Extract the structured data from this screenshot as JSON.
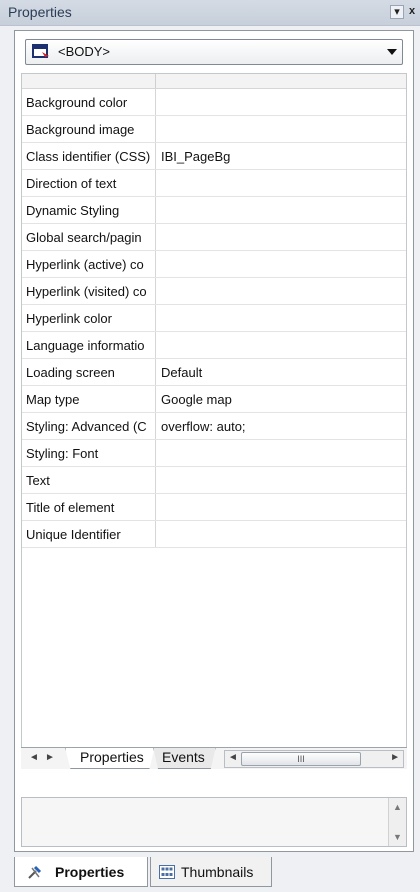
{
  "window": {
    "title": "Properties",
    "pin_glyph": "▾",
    "close_glyph": "x"
  },
  "element_selector": {
    "value": "<BODY>",
    "icon": "element-icon"
  },
  "properties": [
    {
      "name": "Background color",
      "value": ""
    },
    {
      "name": "Background image",
      "value": ""
    },
    {
      "name": "Class identifier (CSS)",
      "value": "IBI_PageBg"
    },
    {
      "name": "Direction of text",
      "value": ""
    },
    {
      "name": "Dynamic Styling",
      "value": ""
    },
    {
      "name": "Global search/pagin",
      "value": ""
    },
    {
      "name": "Hyperlink (active) co",
      "value": ""
    },
    {
      "name": "Hyperlink (visited) co",
      "value": ""
    },
    {
      "name": "Hyperlink color",
      "value": ""
    },
    {
      "name": "Language informatio",
      "value": ""
    },
    {
      "name": "Loading screen",
      "value": "Default"
    },
    {
      "name": "Map type",
      "value": "Google map"
    },
    {
      "name": "Styling: Advanced (C",
      "value": "overflow: auto;"
    },
    {
      "name": "Styling: Font",
      "value": ""
    },
    {
      "name": "Text",
      "value": ""
    },
    {
      "name": "Title of element",
      "value": ""
    },
    {
      "name": "Unique Identifier",
      "value": ""
    }
  ],
  "inner_tabs": {
    "properties": "Properties",
    "events": "Events",
    "scroll_grip": "III"
  },
  "bottom_tabs": {
    "properties": "Properties",
    "thumbnails": "Thumbnails"
  }
}
